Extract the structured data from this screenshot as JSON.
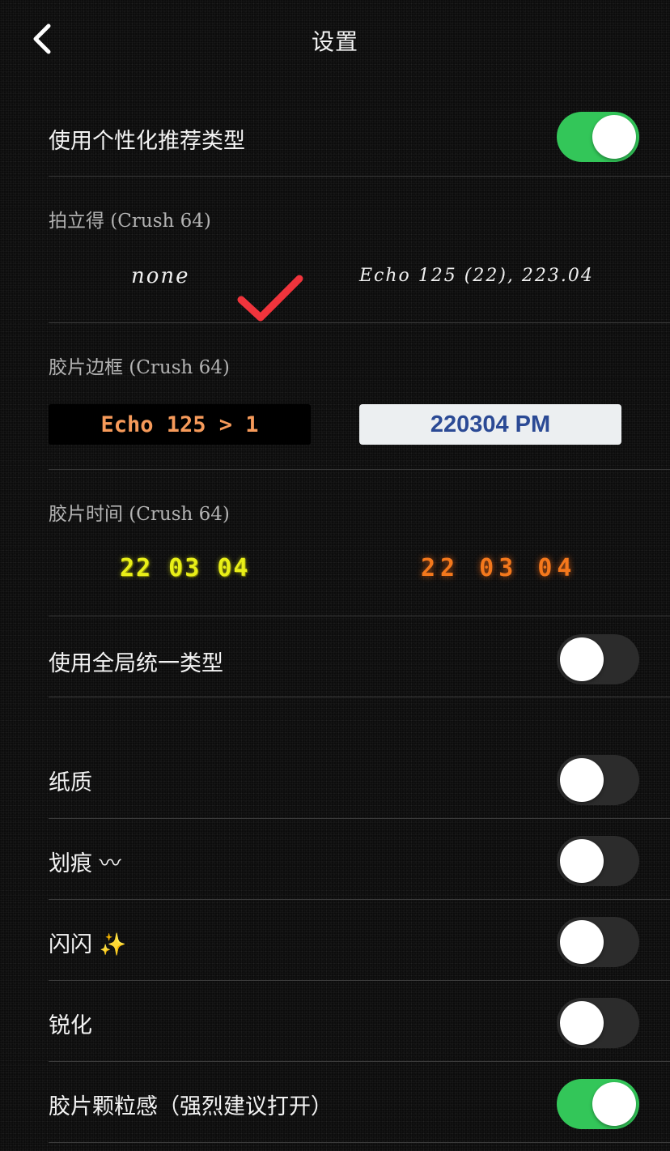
{
  "header": {
    "title": "设置"
  },
  "personalized": {
    "label": "使用个性化推荐类型",
    "enabled": true
  },
  "polaroid": {
    "label": "拍立得 (Crush 64)",
    "options": [
      {
        "text": "none",
        "selected": true
      },
      {
        "text": "Echo  125  (22),  223.04",
        "selected": false
      }
    ]
  },
  "film_border": {
    "label": "胶片边框 (Crush 64)",
    "options": [
      {
        "text": "Echo 125 > 1"
      },
      {
        "text": "220304 PM"
      }
    ]
  },
  "film_time": {
    "label": "胶片时间 (Crush 64)",
    "options": [
      {
        "text": "22 03 04",
        "color": "#e9ef18"
      },
      {
        "text": "22 03 04",
        "color": "#f4781c"
      }
    ]
  },
  "global_type": {
    "label": "使用全局统一类型",
    "enabled": false
  },
  "effects": [
    {
      "label": "纸质",
      "enabled": false
    },
    {
      "label": "划痕 〰",
      "enabled": false
    },
    {
      "label": "闪闪 ✨",
      "enabled": false
    },
    {
      "label": "锐化",
      "enabled": false
    },
    {
      "label": "胶片颗粒感（强烈建议打开）",
      "enabled": true
    }
  ],
  "colors": {
    "toggle_on": "#33c659",
    "toggle_off": "#2c2c2c",
    "check": "#f0343c"
  }
}
